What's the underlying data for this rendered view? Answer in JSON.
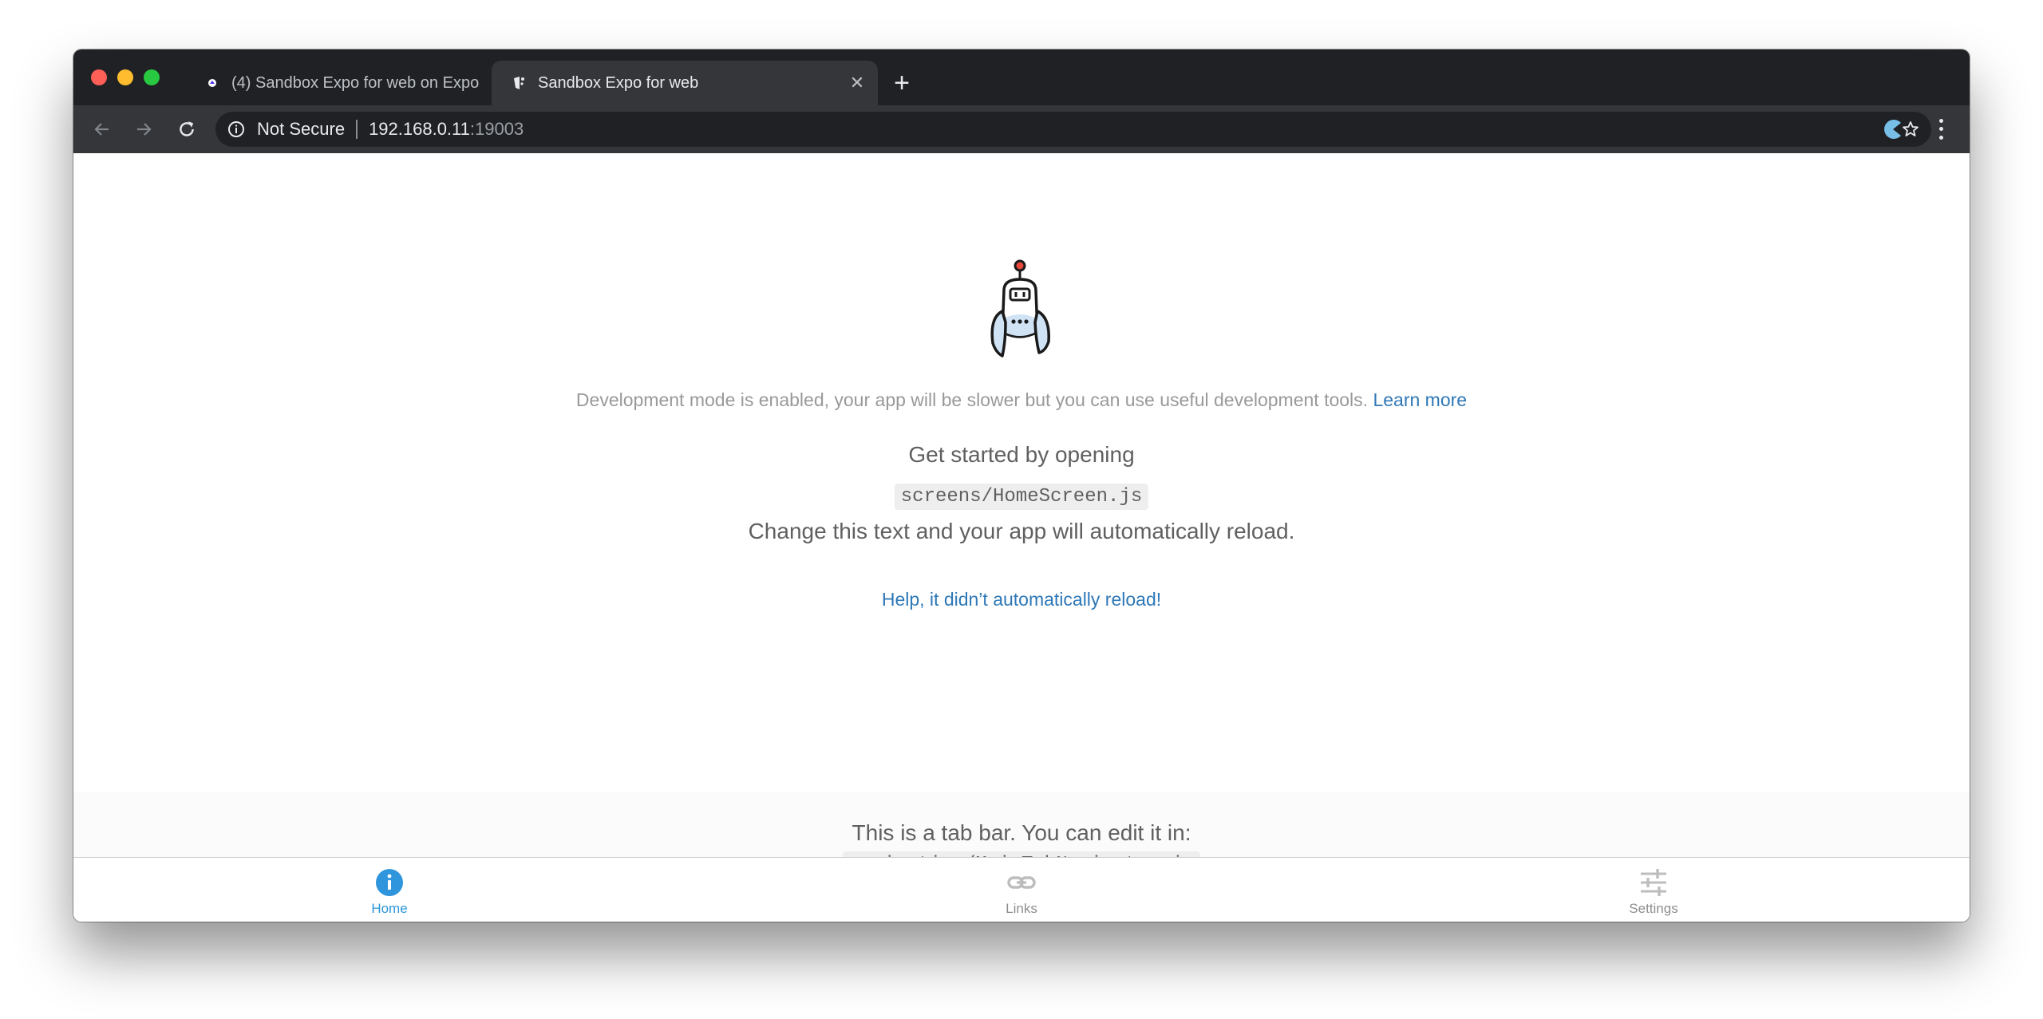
{
  "browser": {
    "tabs": [
      {
        "title": "(4) Sandbox Expo for web on Expo",
        "active": false
      },
      {
        "title": "Sandbox Expo for web",
        "active": true
      }
    ],
    "address": {
      "security_label": "Not Secure",
      "host": "192.168.0.11",
      "port": ":19003"
    }
  },
  "page": {
    "dev_mode_text": "Development mode is enabled, your app will be slower but you can use useful development tools.",
    "learn_more_label": "Learn more",
    "get_started_text": "Get started by opening",
    "home_screen_path": "screens/HomeScreen.js",
    "change_text": "Change this text and your app will automatically reload.",
    "help_link_label": "Help, it didn’t automatically reload!",
    "tab_bar_info_text": "This is a tab bar. You can edit it in:",
    "tab_navigator_path": "navigation/MainTabNavigator.js"
  },
  "bottom_tabs": [
    {
      "label": "Home",
      "icon": "info-icon",
      "active": true
    },
    {
      "label": "Links",
      "icon": "link-icon",
      "active": false
    },
    {
      "label": "Settings",
      "icon": "sliders-icon",
      "active": false
    }
  ],
  "colors": {
    "link": "#2e78b7",
    "active_tab": "#2f95dc",
    "inactive_tab": "#8e8e8e",
    "body_text": "#606062"
  }
}
